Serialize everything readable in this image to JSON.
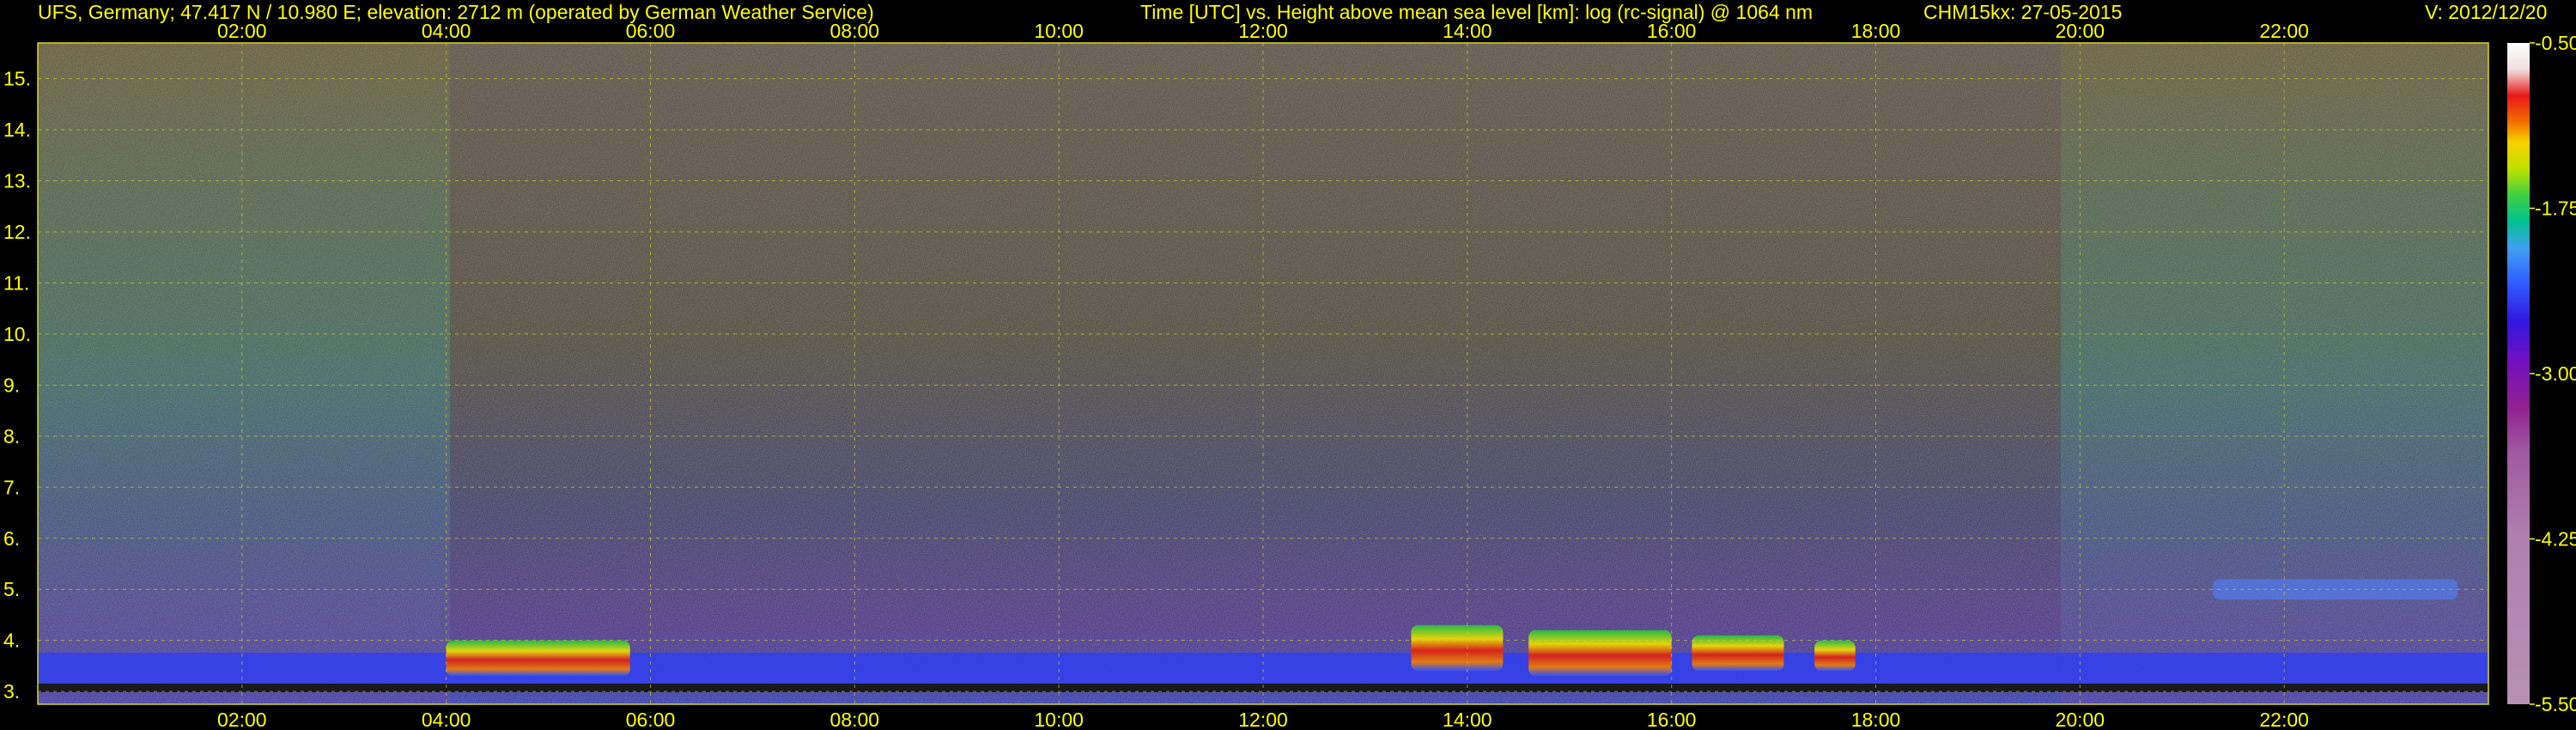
{
  "header": {
    "station": "UFS, Germany; 47.417 N / 10.980 E; elevation: 2712 m  (operated by German Weather Service)",
    "description": "Time [UTC] vs. Height above mean sea level [km]: log (rc-signal) @ 1064 nm",
    "instrument": "CHM15kx: 27-05-2015",
    "version": "V: 2012/12/20"
  },
  "chart_data": {
    "type": "heatmap",
    "title": "",
    "xlabel": "",
    "ylabel": "",
    "x_ticks": [
      "02:00",
      "04:00",
      "06:00",
      "08:00",
      "10:00",
      "12:00",
      "14:00",
      "16:00",
      "18:00",
      "20:00",
      "22:00"
    ],
    "x_tick_hours": [
      2,
      4,
      6,
      8,
      10,
      12,
      14,
      16,
      18,
      20,
      22
    ],
    "xlim_hours": [
      0,
      24
    ],
    "y_ticks": [
      "3.",
      "4.",
      "5.",
      "6.",
      "7.",
      "8.",
      "9.",
      "10.",
      "11.",
      "12.",
      "13.",
      "14.",
      "15."
    ],
    "y_tick_values": [
      3,
      4,
      5,
      6,
      7,
      8,
      9,
      10,
      11,
      12,
      13,
      14,
      15
    ],
    "ylim_km": [
      2.75,
      15.7
    ],
    "grid": true,
    "colorbar": {
      "labels": [
        "-0.50",
        "-1.75",
        "-3.00",
        "-4.25",
        "-5.50"
      ],
      "values": [
        -0.5,
        -1.75,
        -3.0,
        -4.25,
        -5.5
      ],
      "range": [
        -5.5,
        -0.5
      ]
    },
    "features": [
      {
        "name": "cloud",
        "start_hour": 13.45,
        "end_hour": 14.35,
        "base_km": 3.4,
        "top_km": 4.3
      },
      {
        "name": "cloud",
        "start_hour": 14.6,
        "end_hour": 16.0,
        "base_km": 3.3,
        "top_km": 4.2
      },
      {
        "name": "cloud",
        "start_hour": 16.2,
        "end_hour": 17.1,
        "base_km": 3.4,
        "top_km": 4.1
      },
      {
        "name": "cloud",
        "start_hour": 4.0,
        "end_hour": 5.8,
        "base_km": 3.3,
        "top_km": 4.0
      },
      {
        "name": "cloud",
        "start_hour": 17.4,
        "end_hour": 17.8,
        "base_km": 3.4,
        "top_km": 4.0
      },
      {
        "name": "layer",
        "start_hour": 21.3,
        "end_hour": 23.7,
        "base_km": 4.8,
        "top_km": 5.2
      }
    ],
    "colors": {
      "background": "#000000",
      "text": "#ffff00",
      "grid": "#d8d820"
    }
  }
}
